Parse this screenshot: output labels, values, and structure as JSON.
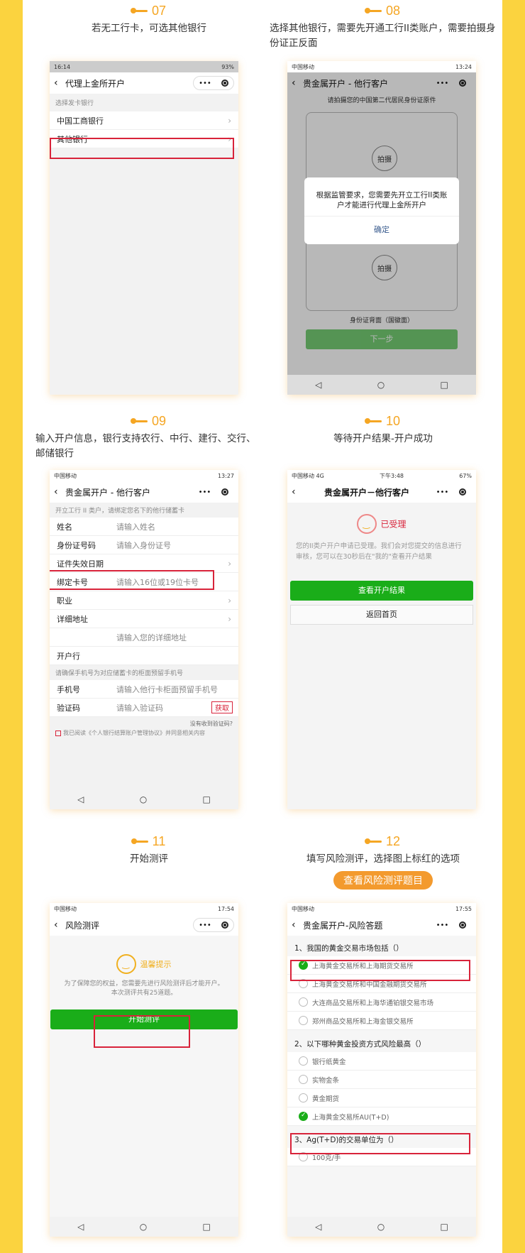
{
  "steps": [
    {
      "num": "07",
      "caption": "若无工行卡，可选其他银行"
    },
    {
      "num": "08",
      "caption": "选择其他银行，需要先开通工行II类账户，需要拍摄身份证正反面"
    },
    {
      "num": "09",
      "caption": "输入开户信息，银行支持农行、中行、建行、交行、邮储银行"
    },
    {
      "num": "10",
      "caption": "等待开户结果-开户成功"
    },
    {
      "num": "11",
      "caption": "开始测评"
    },
    {
      "num": "12",
      "caption": "填写风险测评，选择图上标红的选项",
      "button": "查看风险测评题目"
    }
  ],
  "p7": {
    "time": "16:14",
    "battery": "93%",
    "title": "代理上金所开户",
    "section": "选择发卡银行",
    "bank1": "中国工商银行",
    "bank2": "其他银行"
  },
  "p8": {
    "carrier": "中国移动",
    "time": "13:24",
    "title": "贵金属开户 - 他行客户",
    "hint": "请拍摄您的中国第二代居民身份证原件",
    "shoot": "拍摄",
    "dialog": "根据监管要求，您需要先开立工行II类账户才能进行代理上金所开户",
    "ok": "确定",
    "back_label": "身份证背面（国徽面）",
    "next": "下一步"
  },
  "p9": {
    "carrier": "中国移动",
    "time": "13:27",
    "title": "贵金属开户 - 他行客户",
    "section": "开立工行 II 类户，请绑定您名下的他行储蓄卡",
    "rows": [
      {
        "label": "姓名",
        "placeholder": "请输入姓名"
      },
      {
        "label": "身份证号码",
        "placeholder": "请输入身份证号"
      },
      {
        "label": "证件失效日期",
        "placeholder": ""
      },
      {
        "label": "绑定卡号",
        "placeholder": "请输入16位或19位卡号"
      },
      {
        "label": "职业",
        "placeholder": ""
      },
      {
        "label": "详细地址",
        "placeholder": ""
      },
      {
        "label": "",
        "placeholder": "请输入您的详细地址"
      },
      {
        "label": "开户行",
        "placeholder": ""
      }
    ],
    "section2": "请确保手机号为对应储蓄卡的柜面预留手机号",
    "phone_label": "手机号",
    "phone_ph": "请输入他行卡柜面预留手机号",
    "code_label": "验证码",
    "code_ph": "请输入验证码",
    "get": "获取",
    "nocode": "没有收到验证码?",
    "agree": "我已阅读《个人银行结算账户管理协议》并同意相关内容"
  },
  "p10": {
    "carrier": "中国移动",
    "net": "4G",
    "time": "下午3:48",
    "battery": "67%",
    "title": "贵金属开户－他行客户",
    "status": "已受理",
    "msg": "您的II类户开户申请已受理。我们会对您提交的信息进行审核，您可以在30秒后在\"我的\"查看开户结果",
    "btn1": "查看开户结果",
    "btn2": "返回首页"
  },
  "p11": {
    "carrier": "中国移动",
    "time": "17:54",
    "title": "风险测评",
    "tip": "温馨提示",
    "msg": "为了保障您的权益，您需要先进行风险测评后才能开户。本次测评共有25道题。",
    "btn": "开始测评"
  },
  "p12": {
    "carrier": "中国移动",
    "time": "17:55",
    "title": "贵金属开户-风险答题",
    "q1": "1、我国的黄金交易市场包括（）",
    "q1opts": [
      "上海黄金交易所和上海期货交易所",
      "上海黄金交易所和中国金融期货交易所",
      "大连商品交易所和上海华通铂银交易市场",
      "郑州商品交易所和上海金银交易所"
    ],
    "q2": "2、以下哪种黄金投资方式风险最高（）",
    "q2opts": [
      "银行纸黄金",
      "实物金条",
      "黄金期货",
      "上海黄金交易所AU(T+D)"
    ],
    "q3": "3、Ag(T+D)的交易单位为（）",
    "q3opts": [
      "100克/手"
    ]
  },
  "colors": {
    "accent": "#f5a623",
    "frame": "#fbd33f",
    "highlight": "#d8233a",
    "green": "#1aad19"
  }
}
